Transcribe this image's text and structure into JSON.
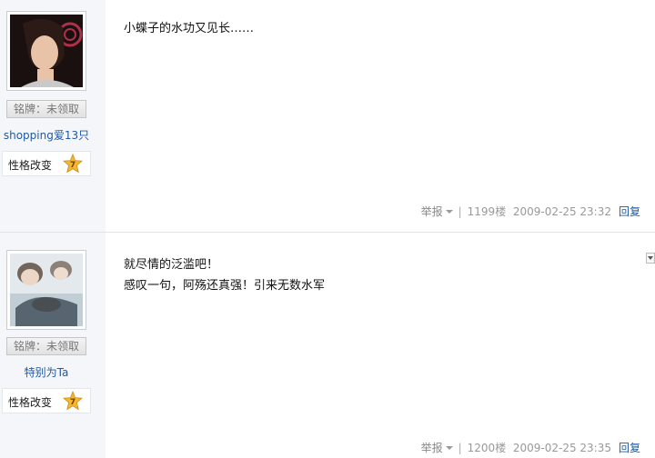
{
  "posts": [
    {
      "medal_label": "铭牌：未领取",
      "username": "shopping爱13只",
      "trait_label": "性格改变",
      "trait_level": "7",
      "content_lines": [
        "小蝶子的水功又见长……"
      ],
      "report_label": "举报",
      "floor": "1199楼",
      "timestamp": "2009-02-25 23:32",
      "reply_label": "回复"
    },
    {
      "medal_label": "铭牌：未领取",
      "username": "特别为Ta",
      "trait_label": "性格改变",
      "trait_level": "7",
      "content_lines": [
        "就尽情的泛滥吧！",
        "感叹一句，阿殇还真强！引来无数水军"
      ],
      "report_label": "举报",
      "floor": "1200楼",
      "timestamp": "2009-02-25 23:35",
      "reply_label": "回复"
    }
  ],
  "colors": {
    "link": "#2259a5",
    "sidebar_bg": "#f4f6f9",
    "star": "#f2b82e"
  }
}
